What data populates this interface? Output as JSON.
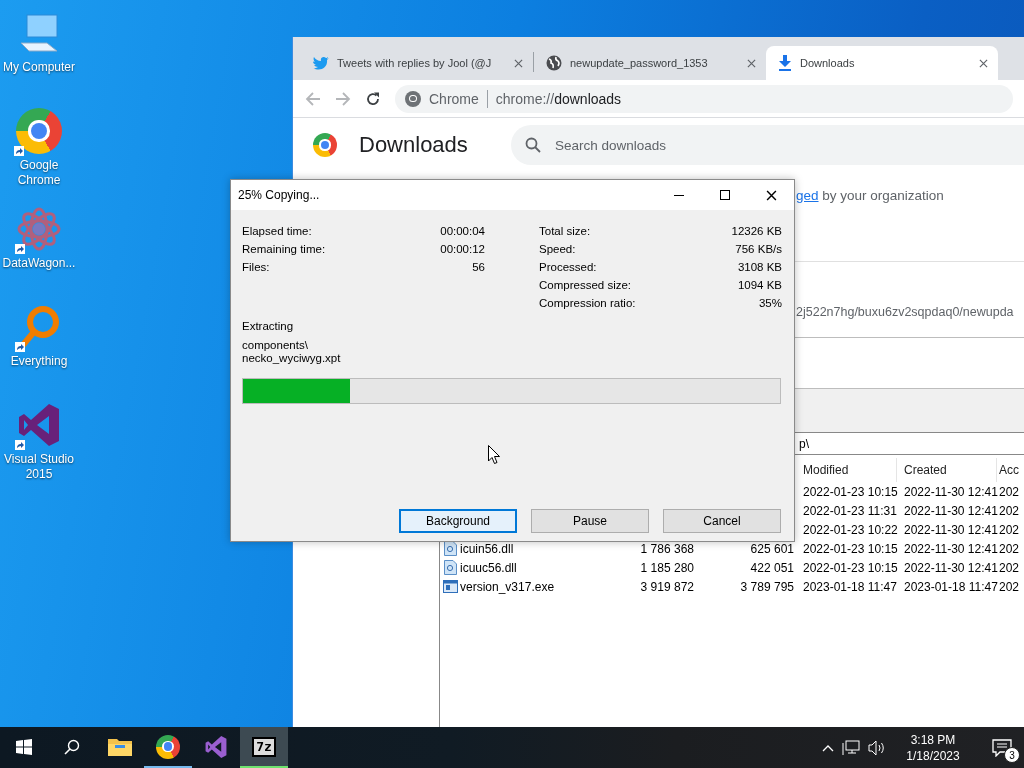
{
  "desktop_icons": [
    {
      "label": "My Computer",
      "kind": "computer",
      "shortcut": false
    },
    {
      "label": "Google Chrome",
      "kind": "chrome",
      "shortcut": true
    },
    {
      "label": "DataWagon...",
      "kind": "datawagon",
      "shortcut": true
    },
    {
      "label": "Everything",
      "kind": "everything",
      "shortcut": true
    },
    {
      "label": "Visual Studio 2015",
      "kind": "visualstudio",
      "shortcut": true
    }
  ],
  "browser": {
    "tabs": [
      {
        "title": "Tweets with replies by Jool (@J",
        "kind": "bird",
        "selected": false
      },
      {
        "title": "newupdate_password_1353",
        "kind": "globe",
        "selected": false
      },
      {
        "title": "Downloads",
        "kind": "download",
        "selected": true
      }
    ],
    "toolbar": {
      "site": "Chrome",
      "url_scheme": "chrome://",
      "url_path": "downloads"
    },
    "page": {
      "title": "Downloads",
      "search": {
        "placeholder": "Search downloads"
      },
      "managed_notice": {
        "link": "ged",
        "text": "by your organization"
      },
      "download_url": "2j522n7hg/buxu6zv2sqpdaq0/newupda"
    }
  },
  "file_manager": {
    "path": "p\\",
    "columns": [
      "Modified",
      "Created",
      "Acc"
    ],
    "rows": [
      {
        "modified": "2022-01-23 10:15",
        "created": "2022-11-30 12:41",
        "accessed": "202"
      },
      {
        "modified": "2022-01-23 11:31",
        "created": "2022-11-30 12:41",
        "accessed": "202"
      },
      {
        "modified": "2022-01-23 10:22",
        "created": "2022-11-30 12:41",
        "accessed": "202"
      },
      {
        "kind": "dll",
        "name": "icuin56.dll",
        "size": "1 786 368",
        "packed_size": "625 601",
        "modified": "2022-01-23 10:15",
        "created": "2022-11-30 12:41",
        "accessed": "202"
      },
      {
        "kind": "dll",
        "name": "icuuc56.dll",
        "size": "1 185 280",
        "packed_size": "422 051",
        "modified": "2022-01-23 10:15",
        "created": "2022-11-30 12:41",
        "accessed": "202"
      },
      {
        "kind": "exe",
        "name": "version_v317.exe",
        "size": "3 919 872",
        "packed_size": "3 789 795",
        "modified": "2023-01-18 11:47",
        "created": "2023-01-18 11:47",
        "accessed": "202"
      }
    ]
  },
  "dialog": {
    "title": "25% Copying...",
    "left_stats": [
      {
        "label": "Elapsed time:",
        "value": "00:00:04"
      },
      {
        "label": "Remaining time:",
        "value": "00:00:12"
      },
      {
        "label": "Files:",
        "value": "56"
      }
    ],
    "right_stats": [
      {
        "label": "Total size:",
        "value": "12326 KB"
      },
      {
        "label": "Speed:",
        "value": "756 KB/s"
      },
      {
        "label": "Processed:",
        "value": "3108 KB"
      },
      {
        "label": "Compressed size:",
        "value": "1094 KB"
      },
      {
        "label": "Compression ratio:",
        "value": "35%"
      }
    ],
    "status": "Extracting",
    "current_file": [
      "components\\",
      "necko_wyciwyg.xpt"
    ],
    "progress": {
      "level": 0.2
    },
    "buttons": [
      {
        "label": "Background",
        "focused": true
      },
      {
        "label": "Pause",
        "focused": false
      },
      {
        "label": "Cancel",
        "focused": false
      }
    ]
  },
  "taskbar": {
    "apps": [
      {
        "kind": "explorer",
        "running": false,
        "selected": false
      },
      {
        "kind": "chrome",
        "running": true,
        "selected": false
      },
      {
        "kind": "visualstudio",
        "running": false,
        "selected": false
      },
      {
        "kind": "sevenzip",
        "label": "7z",
        "running": true,
        "selected": true
      }
    ],
    "clock": {
      "time": "3:18 PM",
      "date": "1/18/2023"
    },
    "notifications": "3"
  }
}
